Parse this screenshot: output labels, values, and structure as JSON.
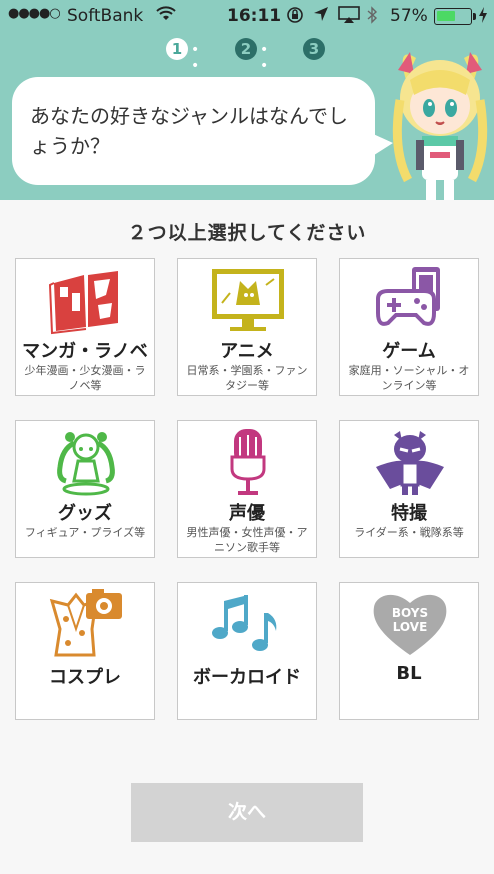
{
  "status_bar": {
    "signal": "●●●●○",
    "carrier": "SoftBank",
    "time": "16:11",
    "battery_percent": "57%",
    "battery_level": 0.57
  },
  "steps": {
    "step1": "1",
    "step2": "2",
    "step3": "3",
    "current": 1
  },
  "header": {
    "question": "あなたの好きなジャンルはなんでしょうか？"
  },
  "prompt": "２つ以上選択してください",
  "genres": [
    {
      "title": "マンガ・ラノベ",
      "sub": "少年漫画・少女漫画・ラノベ等",
      "icon": "manga-book-icon",
      "color": "#d9413f"
    },
    {
      "title": "アニメ",
      "sub": "日常系・学園系・ファンタジー等",
      "icon": "anime-monitor-icon",
      "color": "#c4b31c"
    },
    {
      "title": "ゲーム",
      "sub": "家庭用・ソーシャル・オンライン等",
      "icon": "game-controller-icon",
      "color": "#8b57a6"
    },
    {
      "title": "グッズ",
      "sub": "フィギュア・プライズ等",
      "icon": "figure-icon",
      "color": "#4fb848"
    },
    {
      "title": "声優",
      "sub": "男性声優・女性声優・アニソン歌手等",
      "icon": "microphone-icon",
      "color": "#c2387f"
    },
    {
      "title": "特撮",
      "sub": "ライダー系・戦隊系等",
      "icon": "hero-icon",
      "color": "#6a4d9c"
    },
    {
      "title": "コスプレ",
      "sub": "",
      "icon": "costume-camera-icon",
      "color": "#d98a2e"
    },
    {
      "title": "ボーカロイド",
      "sub": "",
      "icon": "music-notes-icon",
      "color": "#4fa8c8"
    },
    {
      "title": "BL",
      "sub": "",
      "icon": "heart-icon",
      "color": "#aaaaaa",
      "heart_text_1": "BOYS",
      "heart_text_2": "LOVE"
    }
  ],
  "next_button": "次へ"
}
